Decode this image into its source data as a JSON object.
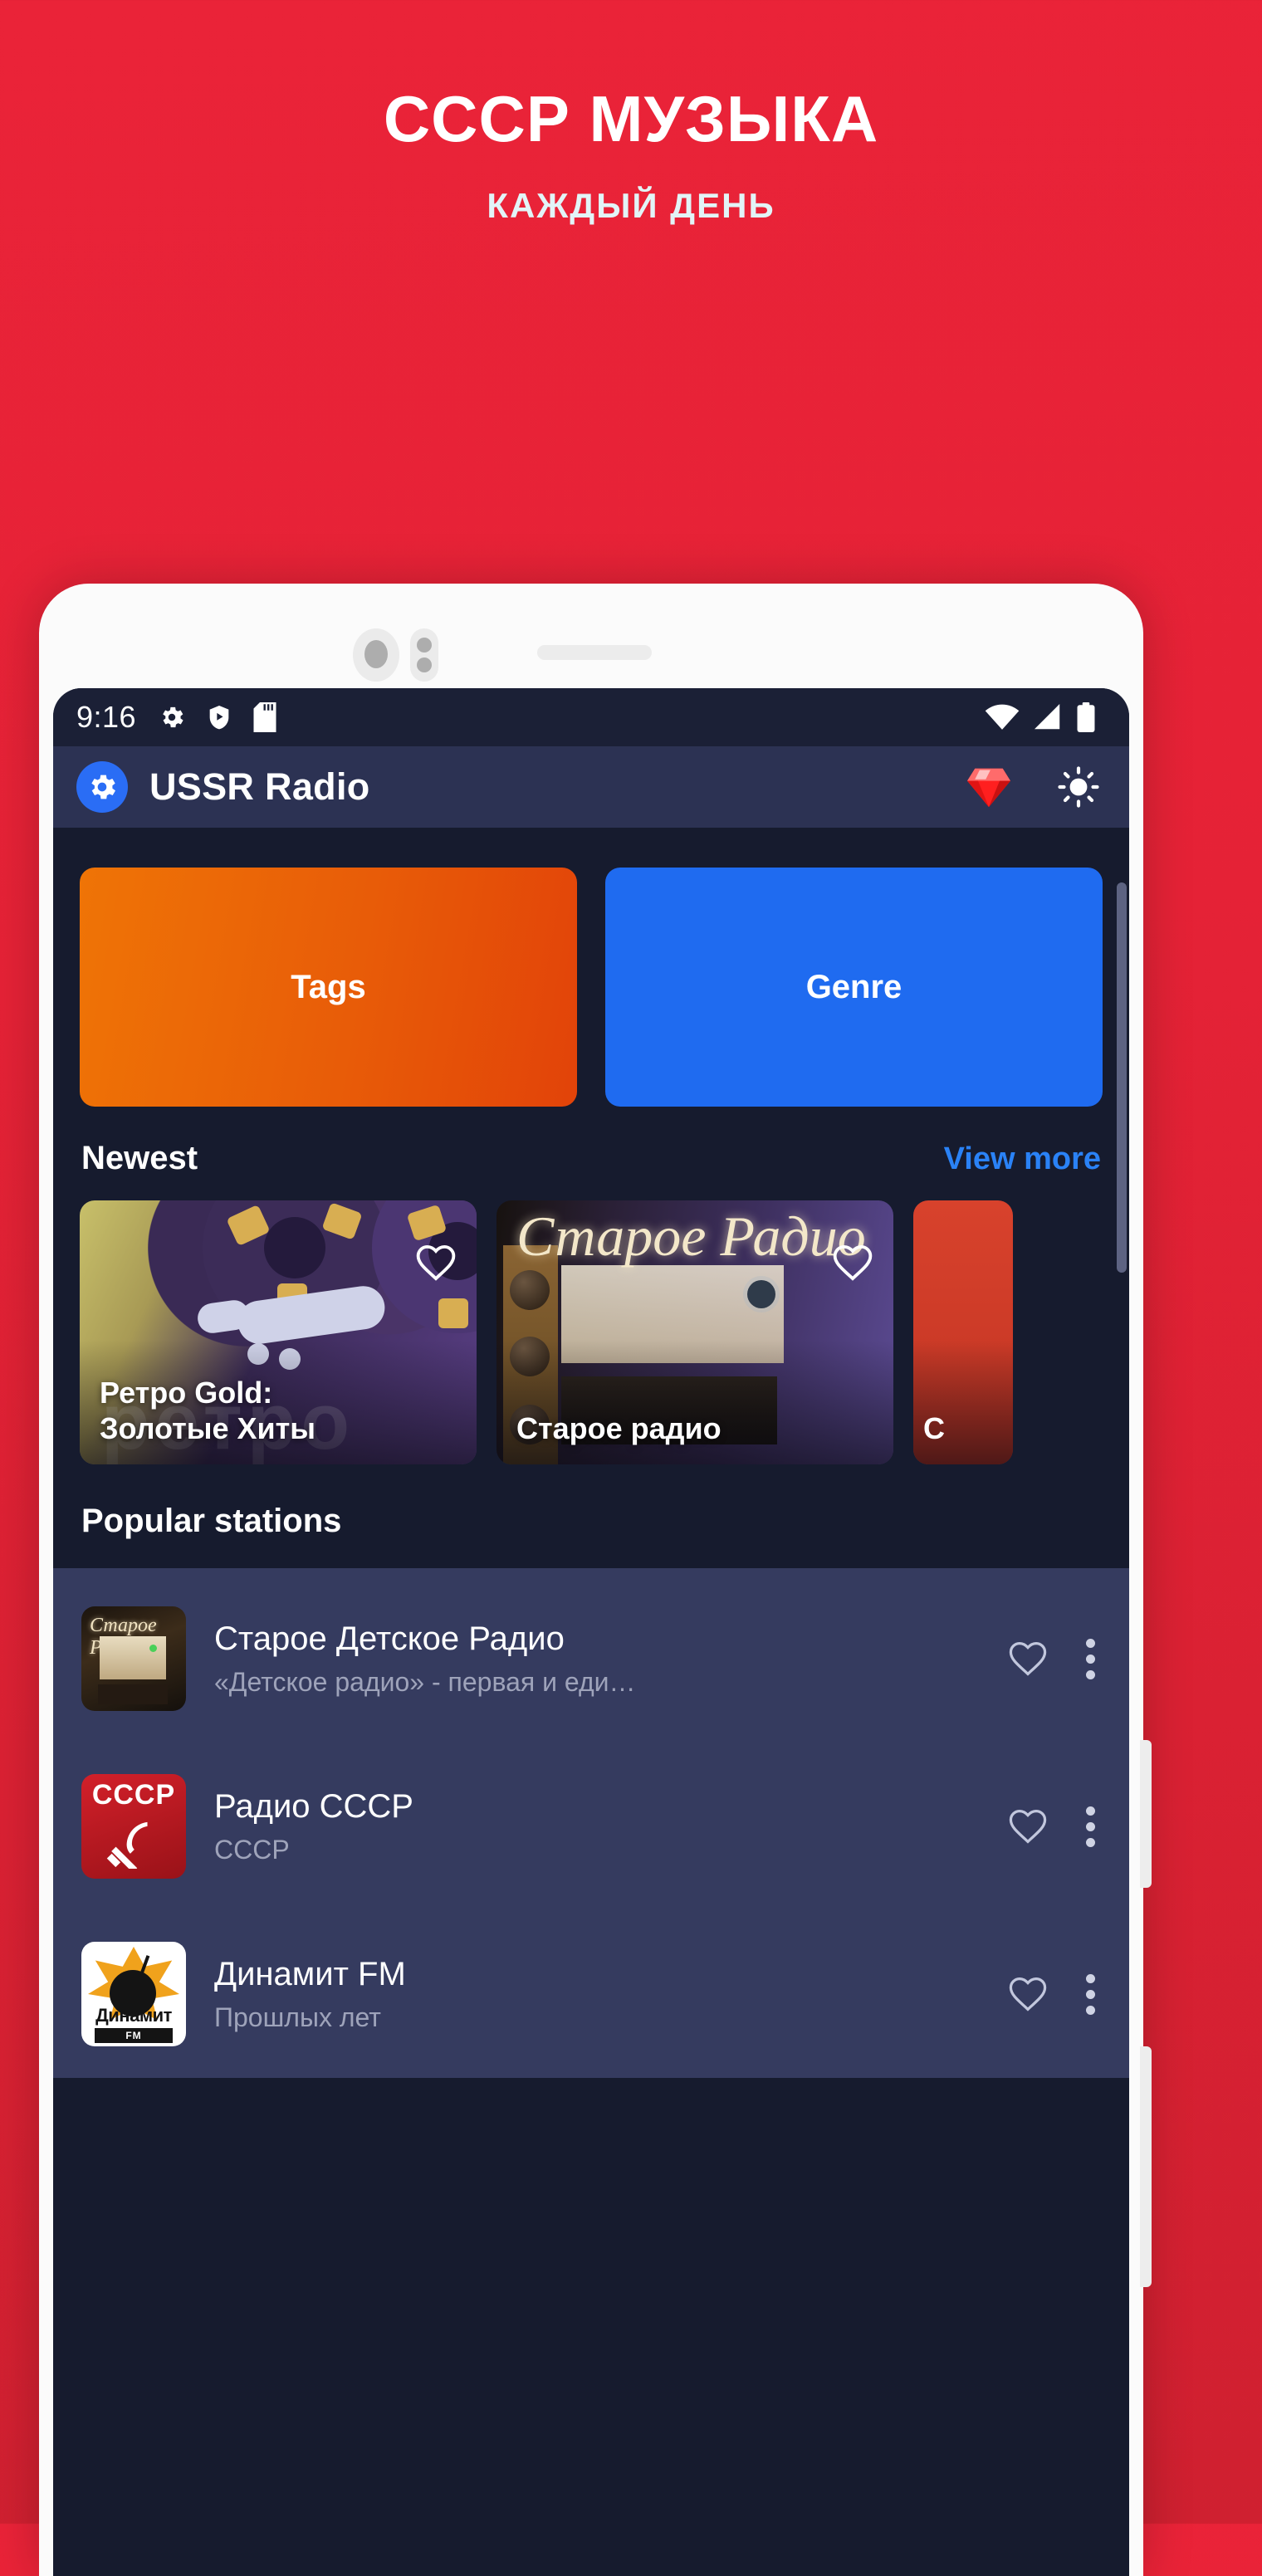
{
  "promo": {
    "title": "СССР МУЗЫКА",
    "subtitle": "КАЖДЫЙ ДЕНЬ",
    "background_color": "#e52236",
    "title_color": "#ffffff",
    "subtitle_color": "#e2f4f7"
  },
  "status_bar": {
    "time": "9:16",
    "left_icons": [
      "gear-icon",
      "play-protect-shield-icon",
      "sd-card-icon"
    ],
    "right_icons": [
      "wifi-icon",
      "cell-signal-icon",
      "battery-icon"
    ]
  },
  "app_bar": {
    "logo_icon": "gear-icon",
    "logo_color": "#2a6df5",
    "title": "USSR Radio",
    "actions": [
      {
        "icon": "gem-icon",
        "color": "#ff2d2d"
      },
      {
        "icon": "sun-icon",
        "color": "#ffffff"
      }
    ]
  },
  "quick_actions": [
    {
      "label": "Tags",
      "color": "#e85c08"
    },
    {
      "label": "Genre",
      "color": "#1f6bf0"
    }
  ],
  "newest": {
    "heading": "Newest",
    "view_more": "View more",
    "cards": [
      {
        "title": "Ретро Gold:\nЗолотые Хиты",
        "title_line1": "Ретро Gold:",
        "title_line2": "Золотые Хиты",
        "favorite_icon": "heart-outline-icon",
        "art_caption": "ретро"
      },
      {
        "title": "Старое радио",
        "favorite_icon": "heart-outline-icon",
        "art_caption": "Старое Радио"
      },
      {
        "title": "C",
        "favorite_icon": "heart-outline-icon"
      }
    ]
  },
  "popular": {
    "heading": "Popular stations",
    "stations": [
      {
        "name": "Старое Детское Радио",
        "description": "«Детское радио» - первая и еди…",
        "thumb": "old-radio-thumb",
        "thumb_label": "Старое Радио",
        "favorite_icon": "heart-outline-icon",
        "menu_icon": "more-vertical-icon"
      },
      {
        "name": "Радио СССР",
        "description": "СССР",
        "thumb": "ussr-flag-thumb",
        "thumb_label": "СССР",
        "favorite_icon": "heart-outline-icon",
        "menu_icon": "more-vertical-icon"
      },
      {
        "name": "Динамит FM",
        "description": "Прошлых лет",
        "thumb": "dynamite-fm-thumb",
        "thumb_label": "Динамит",
        "thumb_sub_label": "FM",
        "favorite_icon": "heart-outline-icon",
        "menu_icon": "more-vertical-icon"
      }
    ]
  }
}
